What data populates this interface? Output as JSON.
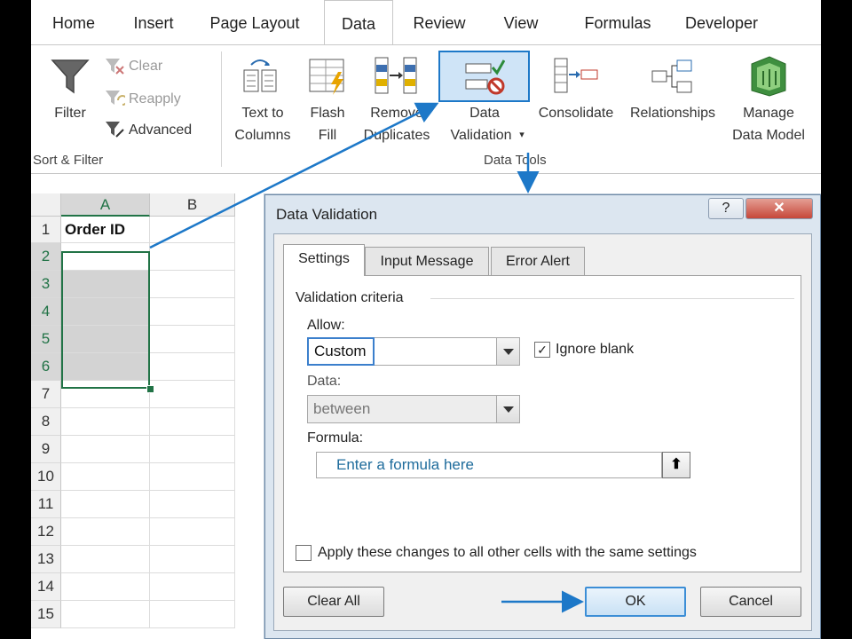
{
  "ribbon": {
    "tabs": [
      "Home",
      "Insert",
      "Page Layout",
      "Data",
      "Review",
      "View",
      "Formulas",
      "Developer"
    ],
    "sort_filter": {
      "filter": "Filter",
      "clear": "Clear",
      "reapply": "Reapply",
      "advanced": "Advanced",
      "group_label": "Sort & Filter"
    },
    "data_tools": {
      "text_to_columns_1": "Text to",
      "text_to_columns_2": "Columns",
      "flash_fill_1": "Flash",
      "flash_fill_2": "Fill",
      "remove_duplicates_1": "Remove",
      "remove_duplicates_2": "Duplicates",
      "data_validation_1": "Data",
      "data_validation_2": "Validation",
      "consolidate": "Consolidate",
      "relationships": "Relationships",
      "manage_1": "Manage",
      "manage_2": "Data Model",
      "group_label": "Data Tools"
    }
  },
  "sheet": {
    "columns": [
      "A",
      "B"
    ],
    "rows": [
      "1",
      "2",
      "3",
      "4",
      "5",
      "6",
      "7",
      "8",
      "9",
      "10",
      "11",
      "12",
      "13",
      "14",
      "15"
    ],
    "a1": "Order ID"
  },
  "dialog": {
    "title": "Data Validation",
    "help": "?",
    "close": "✕",
    "tabs": [
      "Settings",
      "Input Message",
      "Error Alert"
    ],
    "criteria": "Validation criteria",
    "allow_label": "Allow:",
    "allow_value": "Custom",
    "ignore_blank": "Ignore blank",
    "data_label": "Data:",
    "data_value": "between",
    "formula_label": "Formula:",
    "formula_value": "Enter a formula here",
    "apply_all": "Apply these changes to all other cells with the same settings",
    "clear_all": "Clear All",
    "ok": "OK",
    "cancel": "Cancel"
  },
  "colors": {
    "excel_green": "#217346",
    "callout_blue": "#1d78c8"
  }
}
